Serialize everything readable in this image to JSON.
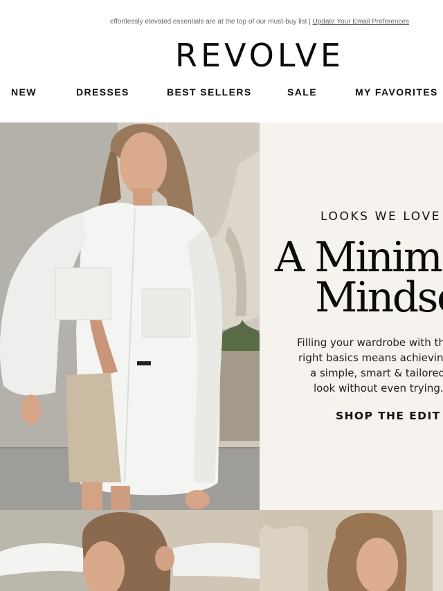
{
  "preheader": {
    "text": "effortlessly elevated essentials are at the top of our must-buy list |",
    "link": "Update Your Email Preferences"
  },
  "brand": {
    "logo": "REVOLVE"
  },
  "nav": {
    "items": [
      {
        "label": "NEW"
      },
      {
        "label": "DRESSES"
      },
      {
        "label": "BEST SELLERS"
      },
      {
        "label": "SALE"
      },
      {
        "label": "MY FAVORITES"
      }
    ]
  },
  "hero": {
    "eyebrow": "LOOKS WE LOVE",
    "headline_line1": "A Minimalist",
    "headline_line2": "Mindset",
    "body": [
      "Filling your wardrobe with the",
      "right basics means achieving",
      "a simple, smart & tailored",
      "look without even trying."
    ],
    "cta": "SHOP THE EDIT"
  },
  "colors": {
    "panel_background": "#f6f2ed",
    "text": "#111111",
    "shirt": "#f4f4f2"
  }
}
